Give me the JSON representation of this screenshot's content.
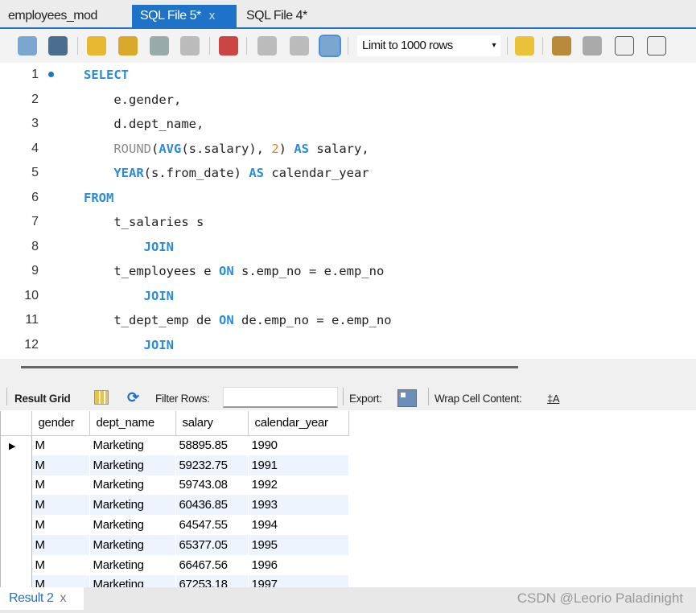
{
  "tabs": [
    {
      "label": "employees_mod",
      "close": ""
    },
    {
      "label": "SQL File 5*",
      "close": "x",
      "active": true
    },
    {
      "label": "SQL File 4*",
      "close": ""
    }
  ],
  "toolbar": {
    "limit_select": "Limit to 1000 rows",
    "limit_arrow": "▾",
    "icons": [
      "open-folder-icon",
      "save-icon",
      "execute-icon",
      "execute-current-icon",
      "explain-icon",
      "stop-icon",
      "toggle-output-icon",
      "commit-icon",
      "rollback-icon",
      "autocommit-icon",
      "bookmark-icon",
      "beautify-icon",
      "find-icon",
      "invisible-chars-icon",
      "word-wrap-icon"
    ]
  },
  "editor": {
    "lines": [
      [
        [
          "kw",
          "SELECT"
        ]
      ],
      [
        [
          "t",
          "    e.gender,"
        ]
      ],
      [
        [
          "t",
          "    d.dept_name,"
        ]
      ],
      [
        [
          "t",
          "    "
        ],
        [
          "fn",
          "ROUND"
        ],
        [
          "t",
          "("
        ],
        [
          "kw",
          "AVG"
        ],
        [
          "t",
          "(s.salary), "
        ],
        [
          "num",
          "2"
        ],
        [
          "t",
          ") "
        ],
        [
          "kw",
          "AS"
        ],
        [
          "t",
          " salary,"
        ]
      ],
      [
        [
          "t",
          "    "
        ],
        [
          "kw",
          "YEAR"
        ],
        [
          "t",
          "(s.from_date) "
        ],
        [
          "kw",
          "AS"
        ],
        [
          "t",
          " calendar_year"
        ]
      ],
      [
        [
          "kw",
          "FROM"
        ]
      ],
      [
        [
          "t",
          "    t_salaries s"
        ]
      ],
      [
        [
          "t",
          "        "
        ],
        [
          "kw",
          "JOIN"
        ]
      ],
      [
        [
          "t",
          "    t_employees e "
        ],
        [
          "kw",
          "ON"
        ],
        [
          "t",
          " s.emp_no = e.emp_no"
        ]
      ],
      [
        [
          "t",
          "        "
        ],
        [
          "kw",
          "JOIN"
        ]
      ],
      [
        [
          "t",
          "    t_dept_emp de "
        ],
        [
          "kw",
          "ON"
        ],
        [
          "t",
          " de.emp_no = e.emp_no"
        ]
      ],
      [
        [
          "t",
          "        "
        ],
        [
          "kw",
          "JOIN"
        ]
      ]
    ]
  },
  "result_toolbar": {
    "result_grid": "Result Grid",
    "filter_rows": "Filter Rows:",
    "filter_value": "",
    "export": "Export:",
    "wrap": "Wrap Cell Content:"
  },
  "grid": {
    "columns": [
      "gender",
      "dept_name",
      "salary",
      "calendar_year"
    ],
    "rows": [
      [
        "M",
        "Marketing",
        "58895.85",
        "1990"
      ],
      [
        "M",
        "Marketing",
        "59232.75",
        "1991"
      ],
      [
        "M",
        "Marketing",
        "59743.08",
        "1992"
      ],
      [
        "M",
        "Marketing",
        "60436.85",
        "1993"
      ],
      [
        "M",
        "Marketing",
        "64547.55",
        "1994"
      ],
      [
        "M",
        "Marketing",
        "65377.05",
        "1995"
      ],
      [
        "M",
        "Marketing",
        "66467.56",
        "1996"
      ],
      [
        "M",
        "Marketing",
        "67253.18",
        "1997"
      ]
    ]
  },
  "bottom": {
    "result_tab": "Result 2",
    "close": "x",
    "watermark": "CSDN @Leorio Paladinight"
  }
}
